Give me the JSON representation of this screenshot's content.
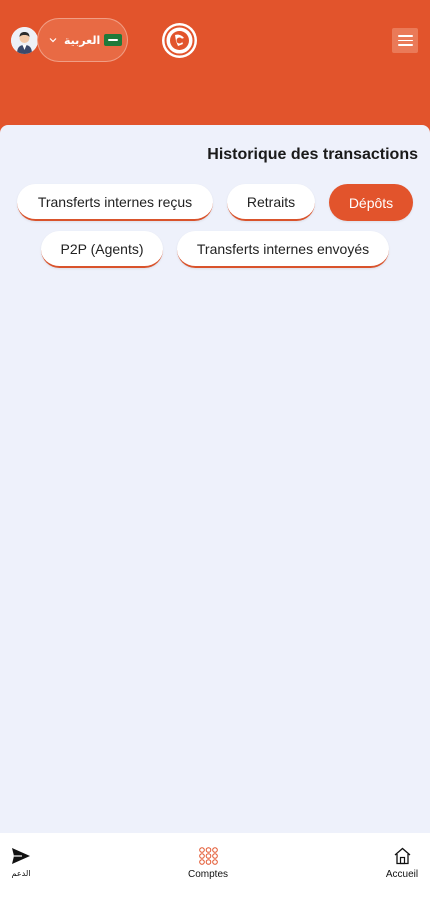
{
  "header": {
    "language_label": "العربية",
    "brand_color": "#e2542c"
  },
  "page": {
    "title": "Historique des transactions"
  },
  "tabs": [
    {
      "label": "Transferts internes reçus",
      "active": false
    },
    {
      "label": "Retraits",
      "active": false
    },
    {
      "label": "Dépôts",
      "active": true
    },
    {
      "label": "P2P (Agents)",
      "active": false
    },
    {
      "label": "Transferts internes envoyés",
      "active": false
    }
  ],
  "bottom_nav": {
    "support_label": "الدعم",
    "accounts_label": "Comptes",
    "home_label": "Accueil"
  },
  "icons": [
    "avatar",
    "chevron-down-icon",
    "flag-icon",
    "logo",
    "menu-icon",
    "send-icon",
    "grid-icon",
    "home-icon"
  ]
}
